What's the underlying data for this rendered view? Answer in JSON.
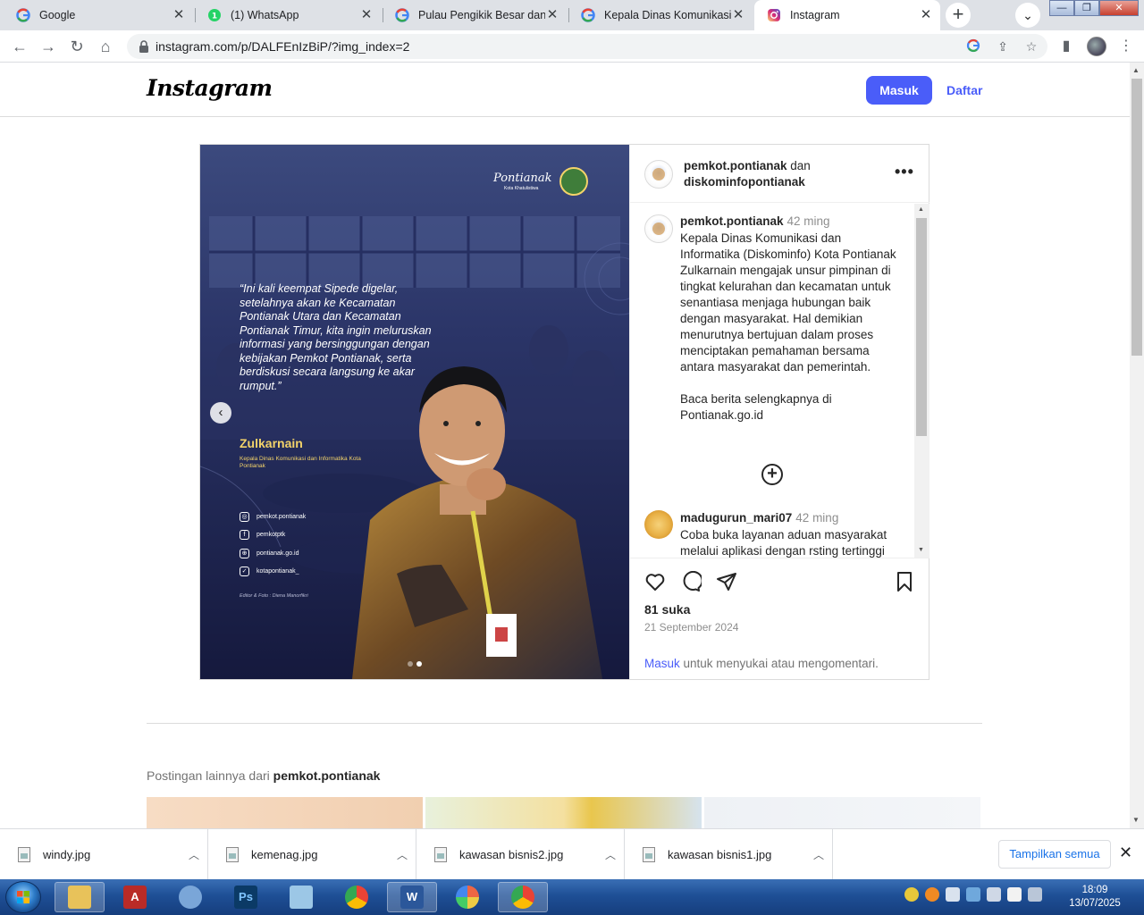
{
  "browser": {
    "tabs": [
      {
        "title": "Google",
        "favicon": "google-icon",
        "active": false
      },
      {
        "title": "(1) WhatsApp",
        "favicon": "whatsapp-icon",
        "active": false
      },
      {
        "title": "Pulau Pengikik Besar dan Pu",
        "favicon": "google-icon",
        "active": false
      },
      {
        "title": "Kepala Dinas Komunikasi da",
        "favicon": "google-icon",
        "active": false
      },
      {
        "title": "Instagram",
        "favicon": "instagram-icon",
        "active": true
      }
    ],
    "url": "instagram.com/p/DALFEnIzBiP/?img_index=2"
  },
  "instagram": {
    "logo": "Instagram",
    "login_button": "Masuk",
    "signup_link": "Daftar"
  },
  "post": {
    "image": {
      "quote": "“Ini kali keempat Sipede digelar, setelahnya akan ke Kecamatan Pontianak Utara dan Kecamatan Pontianak Timur, kita ingin meluruskan informasi yang bersinggungan dengan kebijakan Pemkot Pontianak, serta berdiskusi secara langsung ke akar rumput.”",
      "speaker_name": "Zulkarnain",
      "speaker_title": "Kepala Dinas Komunikasi dan Informatika Kota Pontianak",
      "brand": "Pontianak",
      "brand_sub": "Kota Khatulistiwa",
      "socials": [
        {
          "icon": "instagram-icon",
          "label": "pemkot.pontianak",
          "glyph": "◎"
        },
        {
          "icon": "facebook-icon",
          "label": "pemkotptk",
          "glyph": "f"
        },
        {
          "icon": "globe-icon",
          "label": "pontianak.go.id",
          "glyph": "⊕"
        },
        {
          "icon": "twitter-icon",
          "label": "kotapontianak_",
          "glyph": "✓"
        }
      ],
      "credit": "Editor & Foto : Diena Manorfikri"
    },
    "header": {
      "author": "pemkot.pontianak",
      "conjunction": " dan ",
      "coauthor": "diskominfopontianak"
    },
    "caption": {
      "user": "pemkot.pontianak",
      "time": "42 ming",
      "text": "Kepala Dinas Komunikasi dan Informatika (Diskominfo) Kota Pontianak Zulkarnain mengajak unsur pimpinan di tingkat kelurahan dan kecamatan untuk senantiasa menjaga hubungan baik dengan masyarakat. Hal demikian menurutnya bertujuan dalam proses menciptakan pemahaman bersama antara masyarakat dan pemerintah.\n\nBaca berita selengkapnya di Pontianak.go.id"
    },
    "comment": {
      "user": "madugurun_mari07",
      "time": "42 ming",
      "text": "Coba buka layanan aduan masyarakat melalui aplikasi dengan rsting tertinggi"
    },
    "likes": "81 suka",
    "date": "21 September 2024",
    "login_prompt_link": "Masuk",
    "login_prompt_rest": " untuk menyukai atau mengomentari."
  },
  "more_posts": {
    "label": "Postingan lainnya dari ",
    "account": "pemkot.pontianak"
  },
  "downloads": {
    "items": [
      "windy.jpg",
      "kemenag.jpg",
      "kawasan bisnis2.jpg",
      "kawasan bisnis1.jpg"
    ],
    "show_all": "Tampilkan semua"
  },
  "taskbar": {
    "apps": [
      "explorer-icon",
      "acrobat-icon",
      "paint-icon",
      "photoshop-icon",
      "notepad-icon",
      "chrome-icon",
      "word-icon",
      "browser-icon",
      "chrome-active-icon"
    ],
    "time": "18:09",
    "date": "13/07/2025"
  },
  "colors": {
    "ig_blue": "#4a5df9",
    "taskbar": "#1e4f96",
    "post_bg": "#1c2350"
  }
}
